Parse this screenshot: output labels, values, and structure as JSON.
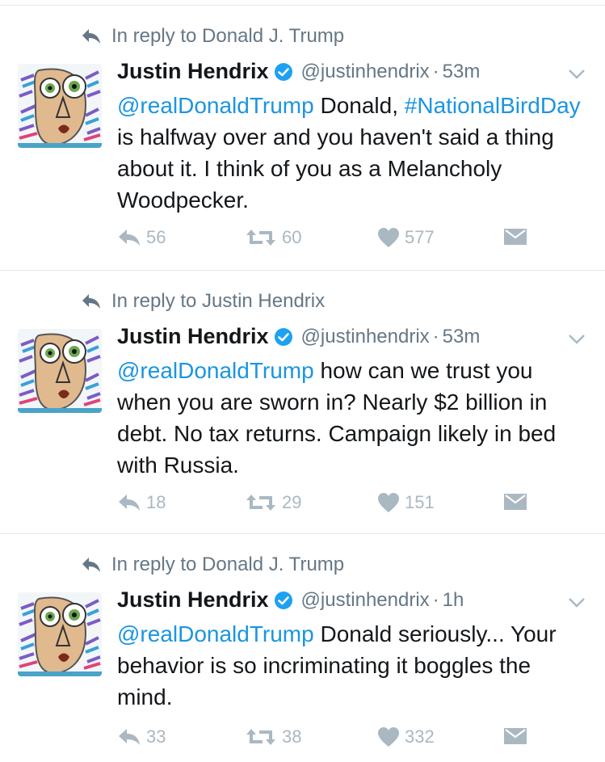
{
  "tweets": [
    {
      "reply_context": "In reply to Donald J. Trump",
      "name": "Justin Hendrix",
      "handle": "@justinhendrix",
      "separator": "·",
      "time": "53m",
      "mention": "@realDonaldTrump",
      "text_1": " Donald, ",
      "hashtag": "#NationalBirdDay",
      "text_2": " is halfway over and you haven't said a thing about it. I think of you as a Melancholy Woodpecker.",
      "replies": "56",
      "retweets": "60",
      "likes": "577"
    },
    {
      "reply_context": "In reply to Justin Hendrix",
      "name": "Justin Hendrix",
      "handle": "@justinhendrix",
      "separator": "·",
      "time": "53m",
      "mention": "@realDonaldTrump",
      "text_1": " how can we trust you when you are sworn in? Nearly $2 billion in debt. No tax returns. Campaign likely in bed with Russia.",
      "replies": "18",
      "retweets": "29",
      "likes": "151"
    },
    {
      "reply_context": "In reply to Donald J. Trump",
      "name": "Justin Hendrix",
      "handle": "@justinhendrix",
      "separator": "·",
      "time": "1h",
      "mention": "@realDonaldTrump",
      "text_1": " Donald seriously... Your behavior is so incriminating it boggles the mind.",
      "replies": "33",
      "retweets": "38",
      "likes": "332"
    }
  ],
  "colors": {
    "link": "#1b95e0",
    "muted": "#657786",
    "action": "#aab8c2",
    "verified": "#1da1f2"
  },
  "icons": [
    "reply-arrow-icon",
    "verified-badge-icon",
    "chevron-down-icon",
    "reply-icon",
    "retweet-icon",
    "heart-icon",
    "direct-message-icon"
  ]
}
